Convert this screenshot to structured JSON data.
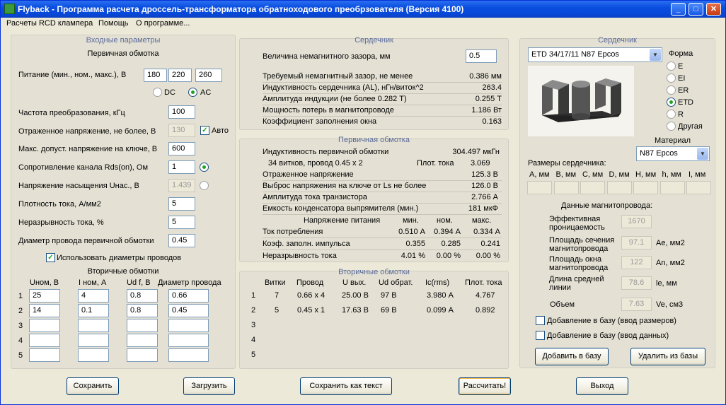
{
  "title": "Flyback - Программа расчета дроссель-трансформатора обратноходового преобрзователя (Версия 4100)",
  "menu": [
    "Расчеты RCD клампера",
    "Помощь",
    "О программе..."
  ],
  "inputs": {
    "header": "Входные параметры",
    "primary_header": "Первичная обмотка",
    "supply_label": "Питание (мин., ном., макс.), В",
    "supply": [
      "180",
      "220",
      "260"
    ],
    "dc": "DC",
    "ac": "AC",
    "freq_label": "Частота преобразования, кГц",
    "freq": "100",
    "reflected_label": "Отраженное напряжение, не более, В",
    "reflected": "130",
    "auto": "Авто",
    "maxv_label": "Макс. допуст. напряжение на ключе, В",
    "maxv": "600",
    "rds_label": "Сопротивление канала Rds(on), Ом",
    "rds": "1",
    "usat_label": "Напряжение насыщения Uнас., В",
    "usat": "1.439",
    "density_label": "Плотность тока, А/мм2",
    "density": "5",
    "ripple_label": "Неразрывность тока, %",
    "ripple": "5",
    "wire_label": "Диаметр провода первичной обмотки",
    "wire": "0.45",
    "use_wire": "Использовать диаметры проводов",
    "secondary_header": "Вторичные обмотки",
    "sec_cols": [
      "Uном, В",
      "I ном, А",
      "Ud f, В",
      "Диаметр провода"
    ],
    "sec_rows": [
      [
        "1",
        "25",
        "4",
        "0.8",
        "0.66"
      ],
      [
        "2",
        "14",
        "0.1",
        "0.8",
        "0.45"
      ],
      [
        "3",
        "",
        "",
        "",
        ""
      ],
      [
        "4",
        "",
        "",
        "",
        ""
      ],
      [
        "5",
        "",
        "",
        "",
        ""
      ]
    ]
  },
  "core": {
    "header": "Сердечник",
    "gap_label": "Величина немагнитного зазора, мм",
    "gap": "0.5",
    "rows": [
      [
        "Требуемый немагнитный зазор, не менее",
        "0.386 мм"
      ],
      [
        "Индуктивность сердечника (AL), нГн/виток^2",
        "263.4"
      ],
      [
        "Амплитуда индукции       (не более 0.282 Т)",
        "0.255 Т"
      ],
      [
        "Мощность потерь в магнитопроводе",
        "1.186 Вт"
      ],
      [
        "Коэффициент заполнения окна",
        "0.163"
      ]
    ]
  },
  "primary": {
    "header": "Первичная обмотка",
    "inductance_label": "Индуктивность первичной обмотки",
    "inductance": "304.497 мкГн",
    "turns": "34 витков,  провод 0.45 x 2",
    "density_label": "Плот. тока",
    "density": "3.069",
    "rows": [
      [
        "Отраженное напряжение",
        "125.3 В"
      ],
      [
        "Выброс напряжения на ключе от Ls не более",
        "126.0 В"
      ],
      [
        "Амплитуда тока транзистора",
        "2.766 А"
      ],
      [
        "Емкость конденсатора выпрямителя (мин.)",
        "181 мкФ"
      ]
    ],
    "supply_header": "Напряжение питания",
    "cols": [
      "мин.",
      "ном.",
      "макс."
    ],
    "tbl": [
      [
        "Ток потребления",
        "0.510 А",
        "0.394 А",
        "0.334 А"
      ],
      [
        "Коэф. заполн. импульса",
        "0.355",
        "0.285",
        "0.241"
      ],
      [
        "Неразрывность тока",
        "4.01 %",
        "0.00 %",
        "0.00 %"
      ]
    ]
  },
  "secondary": {
    "header": "Вторичные обмотки",
    "cols": [
      "Витки",
      "Провод",
      "U вых.",
      "Ud обрат.",
      "Ic(rms)",
      "Плот. тока"
    ],
    "rows": [
      [
        "1",
        "7",
        "0.66 x 4",
        "25.00 В",
        "97 В",
        "3.980 А",
        "4.767"
      ],
      [
        "2",
        "5",
        "0.45 x 1",
        "17.63 В",
        "69 В",
        "0.099 А",
        "0.892"
      ],
      [
        "3",
        "",
        "",
        "",
        "",
        "",
        ""
      ],
      [
        "4",
        "",
        "",
        "",
        "",
        "",
        ""
      ],
      [
        "5",
        "",
        "",
        "",
        "",
        "",
        ""
      ]
    ]
  },
  "rcore": {
    "header": "Сердечник",
    "select": "ETD 34/17/11 N87 Epcos",
    "form_label": "Форма",
    "forms": [
      "E",
      "EI",
      "ER",
      "ETD",
      "R",
      "Другая"
    ],
    "form_selected": "ETD",
    "material_label": "Материал",
    "material": "N87 Epcos",
    "sizes_label": "Размеры сердечника:",
    "sizes": [
      "A, мм",
      "B, мм",
      "C, мм",
      "D, мм",
      "H, мм",
      "h, мм",
      "I, мм"
    ],
    "data_label": "Данные магнитопровода:",
    "mu_label": "Эффективная проницаемость",
    "mu": "1670",
    "ae_label": "Площадь сечения магнитопровода",
    "ae": "97.1",
    "ae_unit": "Ae, мм2",
    "an_label": "Площадь окна магнитопровода",
    "an": "122",
    "an_unit": "An, мм2",
    "le_label": "Длина средней линии",
    "le": "78.6",
    "le_unit": "le, мм",
    "ve_label": "Объем",
    "ve": "7.63",
    "ve_unit": "Ve, см3",
    "add_sizes": "Добавление в базу (ввод размеров)",
    "add_data": "Добавление в базу (ввод данных)",
    "add_btn": "Добавить в базу",
    "del_btn": "Удалить из базы"
  },
  "buttons": {
    "save": "Сохранить",
    "load": "Загрузить",
    "save_text": "Сохранить как текст",
    "calc": "Рассчитать!",
    "exit": "Выход"
  }
}
